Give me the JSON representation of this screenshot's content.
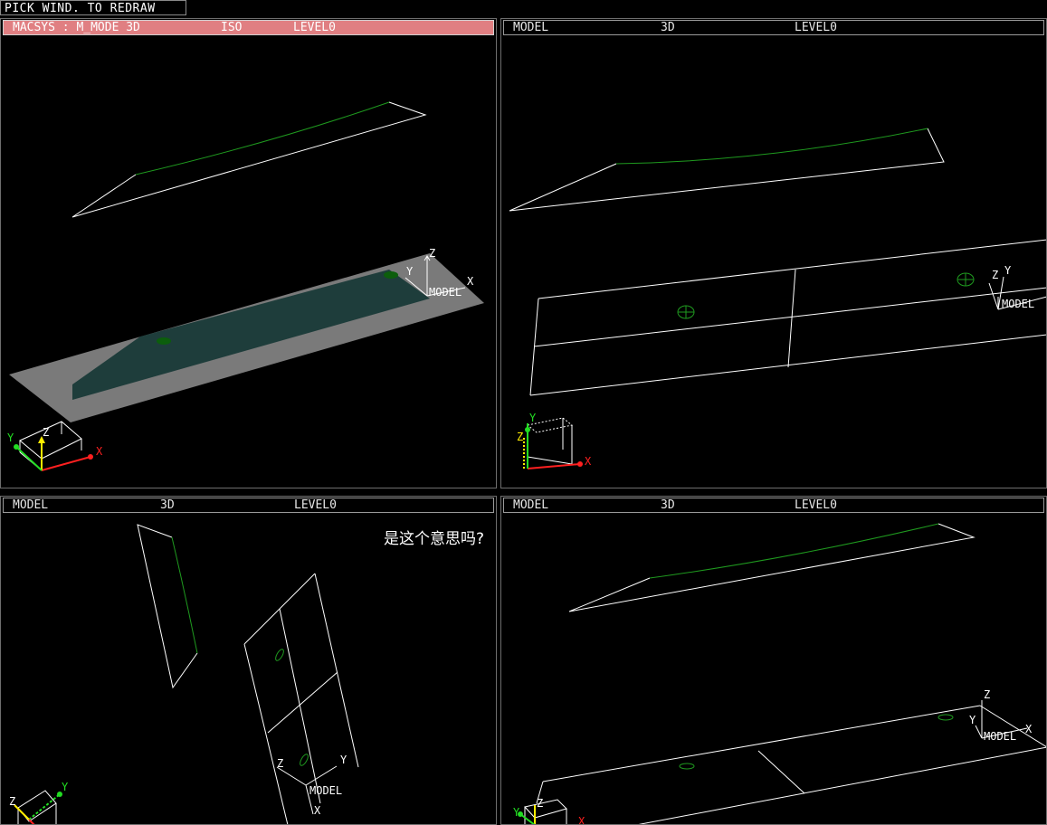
{
  "prompt": {
    "text": "PICK WIND. TO REDRAW"
  },
  "viewports": {
    "top_left": {
      "header": {
        "part1": "MACSYS : M_MODE 3D",
        "part2": "ISO",
        "part3": "LEVEL0"
      },
      "active": true
    },
    "top_right": {
      "header": {
        "part1": "MODEL",
        "part2": "3D",
        "part3": "LEVEL0"
      }
    },
    "bottom_left": {
      "header": {
        "part1": "MODEL",
        "part2": "3D",
        "part3": "LEVEL0"
      }
    },
    "bottom_right": {
      "header": {
        "part1": "MODEL",
        "part2": "3D",
        "part3": "LEVEL0"
      }
    }
  },
  "axis_labels": {
    "x": "X",
    "y": "Y",
    "z": "Z",
    "model": "MODEL"
  },
  "annotation": "是这个意思吗?",
  "colors": {
    "active_header": "#e07f82",
    "wireframe": "#ffffff",
    "curve": "#1f9a1f",
    "shaded_surface": "#1e3d3b",
    "ground_plane": "#7a7a7a",
    "axis_x": "#ff2020",
    "axis_y": "#22dd22",
    "axis_z": "#ffee00"
  }
}
